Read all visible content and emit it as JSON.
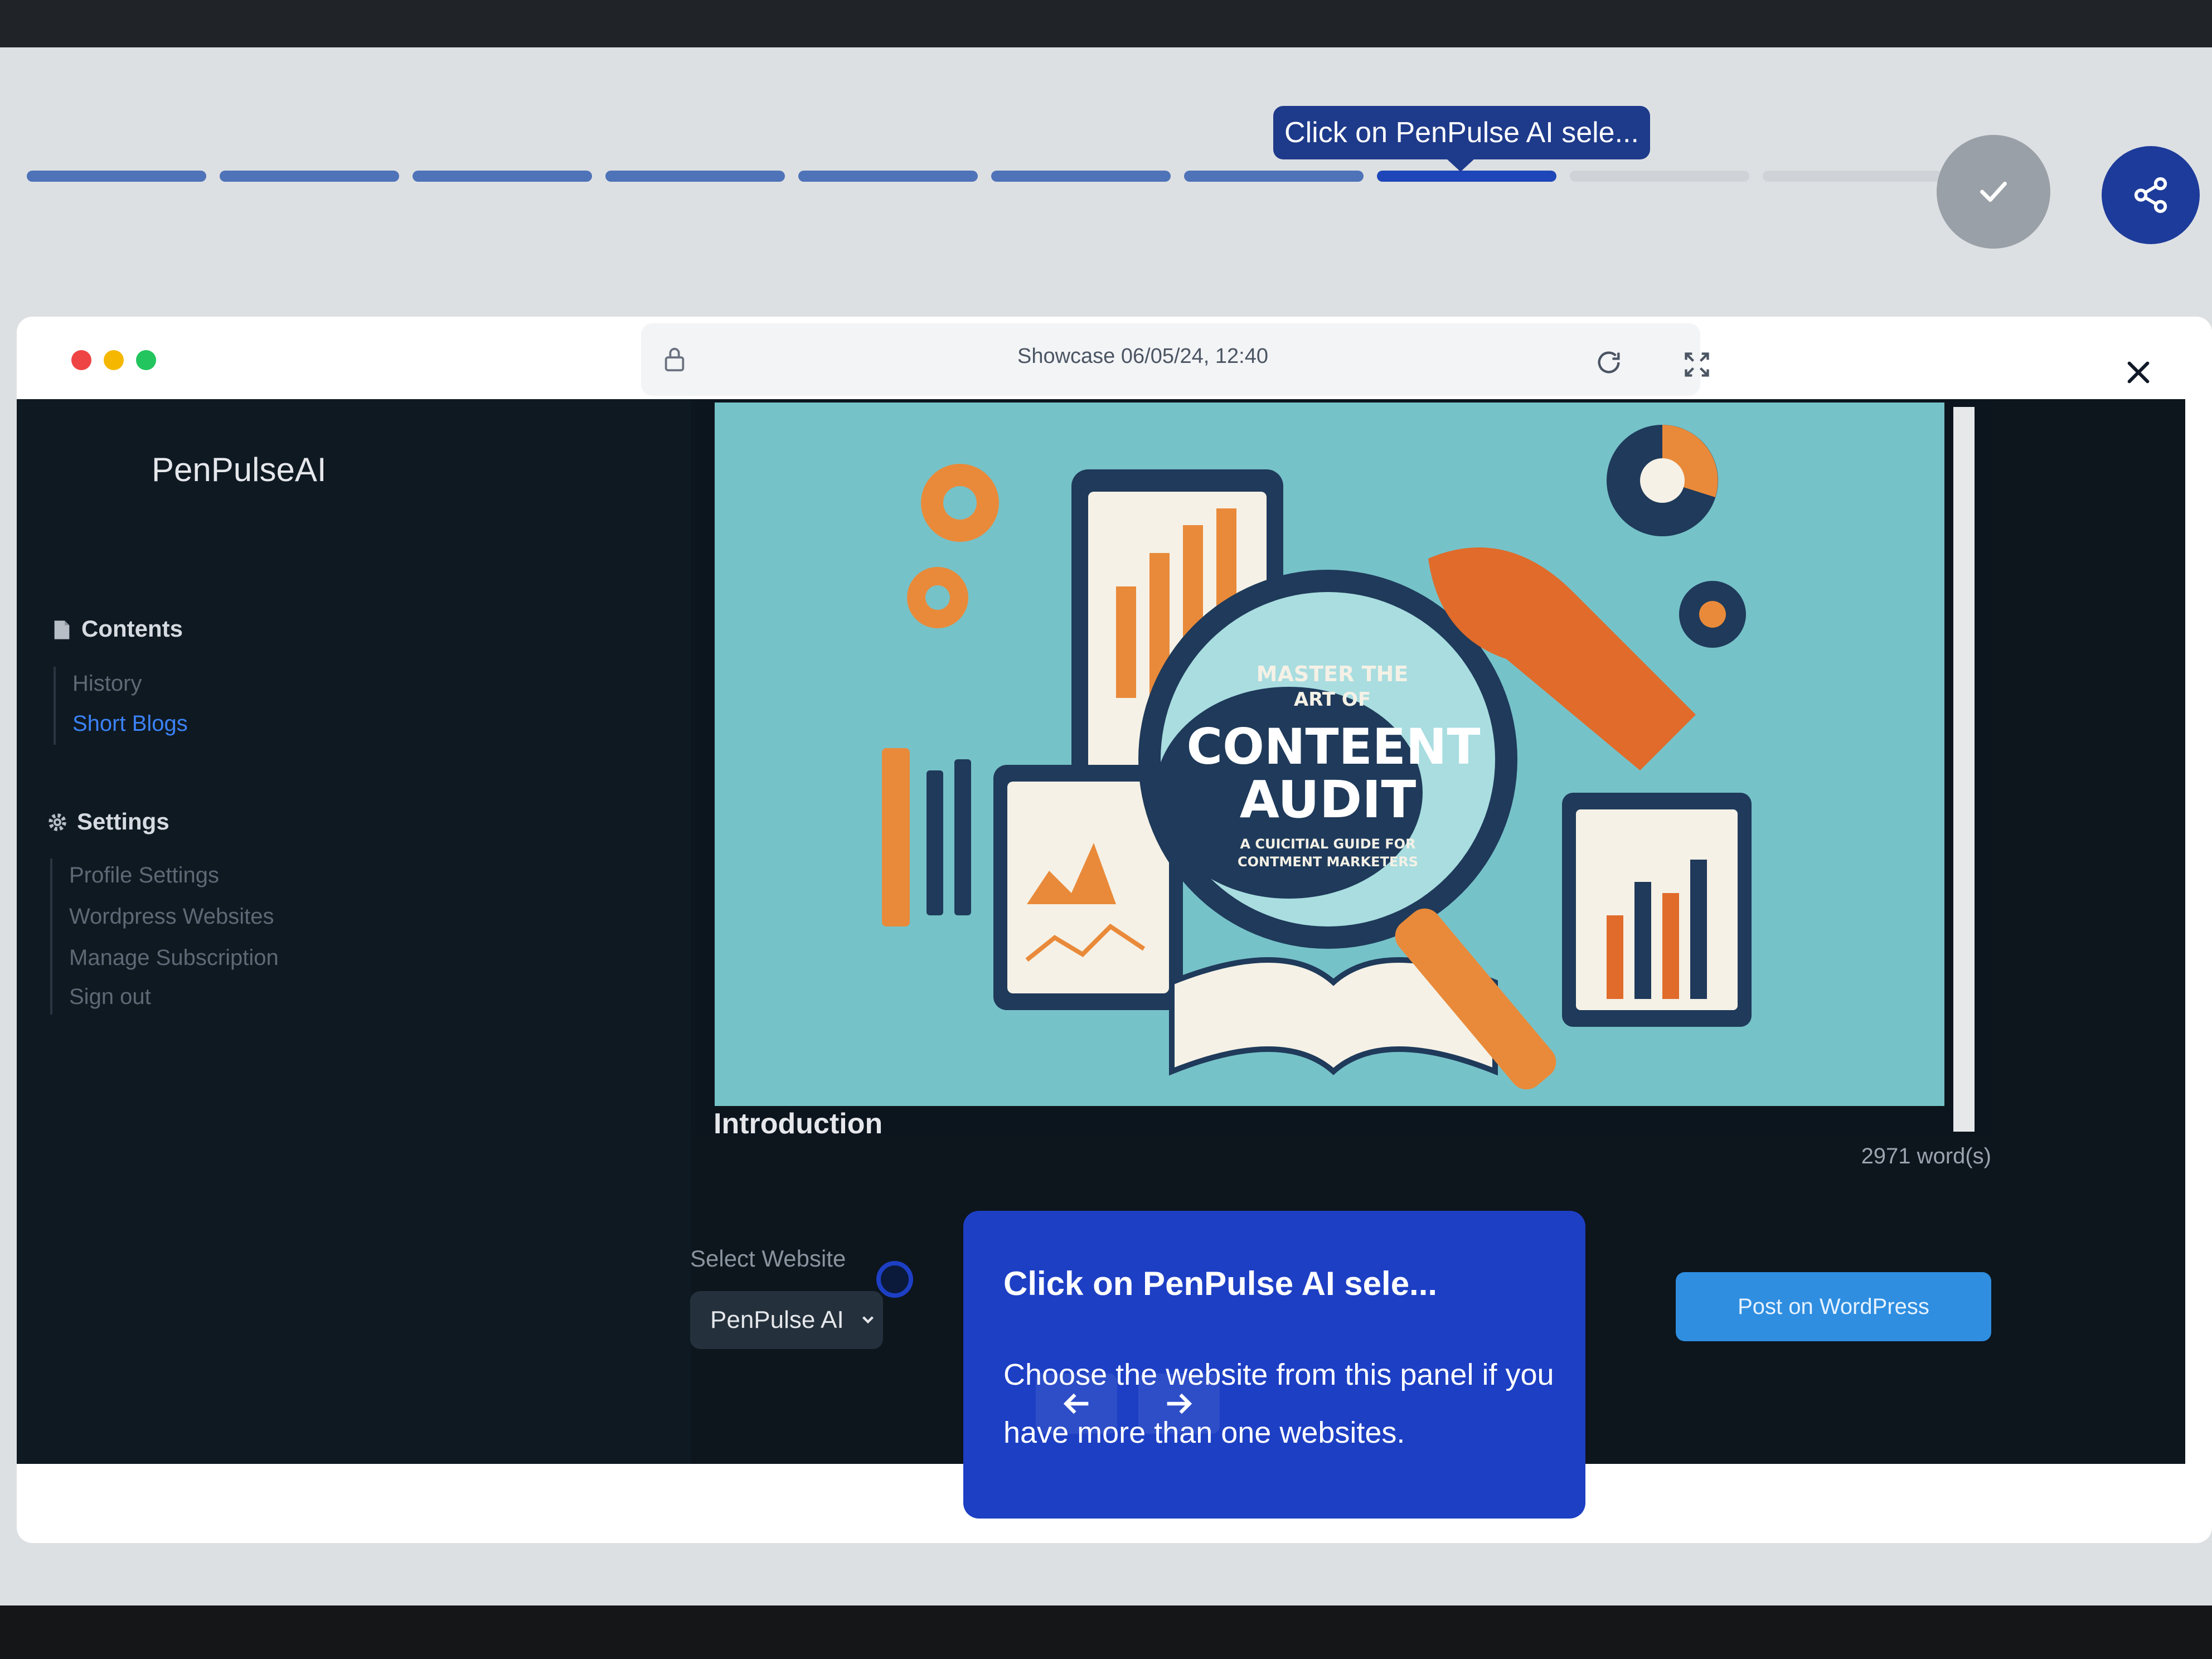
{
  "tour": {
    "tooltip_short": "Click on PenPulse AI sele...",
    "card_title": "Click on PenPulse AI sele...",
    "card_body": "Choose the website from this panel if you have more than one websites.",
    "progress": {
      "total_steps": 10,
      "completed_steps": 7,
      "current_step": 8
    }
  },
  "browser": {
    "address_text": "Showcase 06/05/24, 12:40"
  },
  "sidebar": {
    "brand": "PenPulseAI",
    "contents": {
      "title": "Contents",
      "items": [
        {
          "label": "History"
        },
        {
          "label": "Short Blogs"
        }
      ]
    },
    "settings": {
      "title": "Settings",
      "items": [
        {
          "label": "Profile Settings"
        },
        {
          "label": "Wordpress Websites"
        },
        {
          "label": "Manage Subscription"
        },
        {
          "label": "Sign out"
        }
      ]
    }
  },
  "article": {
    "hero_heading_line1": "MASTER THE",
    "hero_heading_line2": "ART OF",
    "hero_title_line1": "CONTEENT",
    "hero_title_line2": "AUDIT",
    "hero_subtitle_line1": "A CUICITIAL GUIDE FOR",
    "hero_subtitle_line2": "CONTMENT MARKETERS",
    "section_heading": "Introduction",
    "word_count": "2971 word(s)"
  },
  "publish": {
    "select_label": "Select Website",
    "selected_website": "PenPulse AI",
    "post_button": "Post on WordPress"
  },
  "colors": {
    "accent_blue": "#1d3fc4",
    "app_bg": "#0d151d",
    "link_active": "#3b82f6",
    "post_button": "#2f8ee0"
  }
}
